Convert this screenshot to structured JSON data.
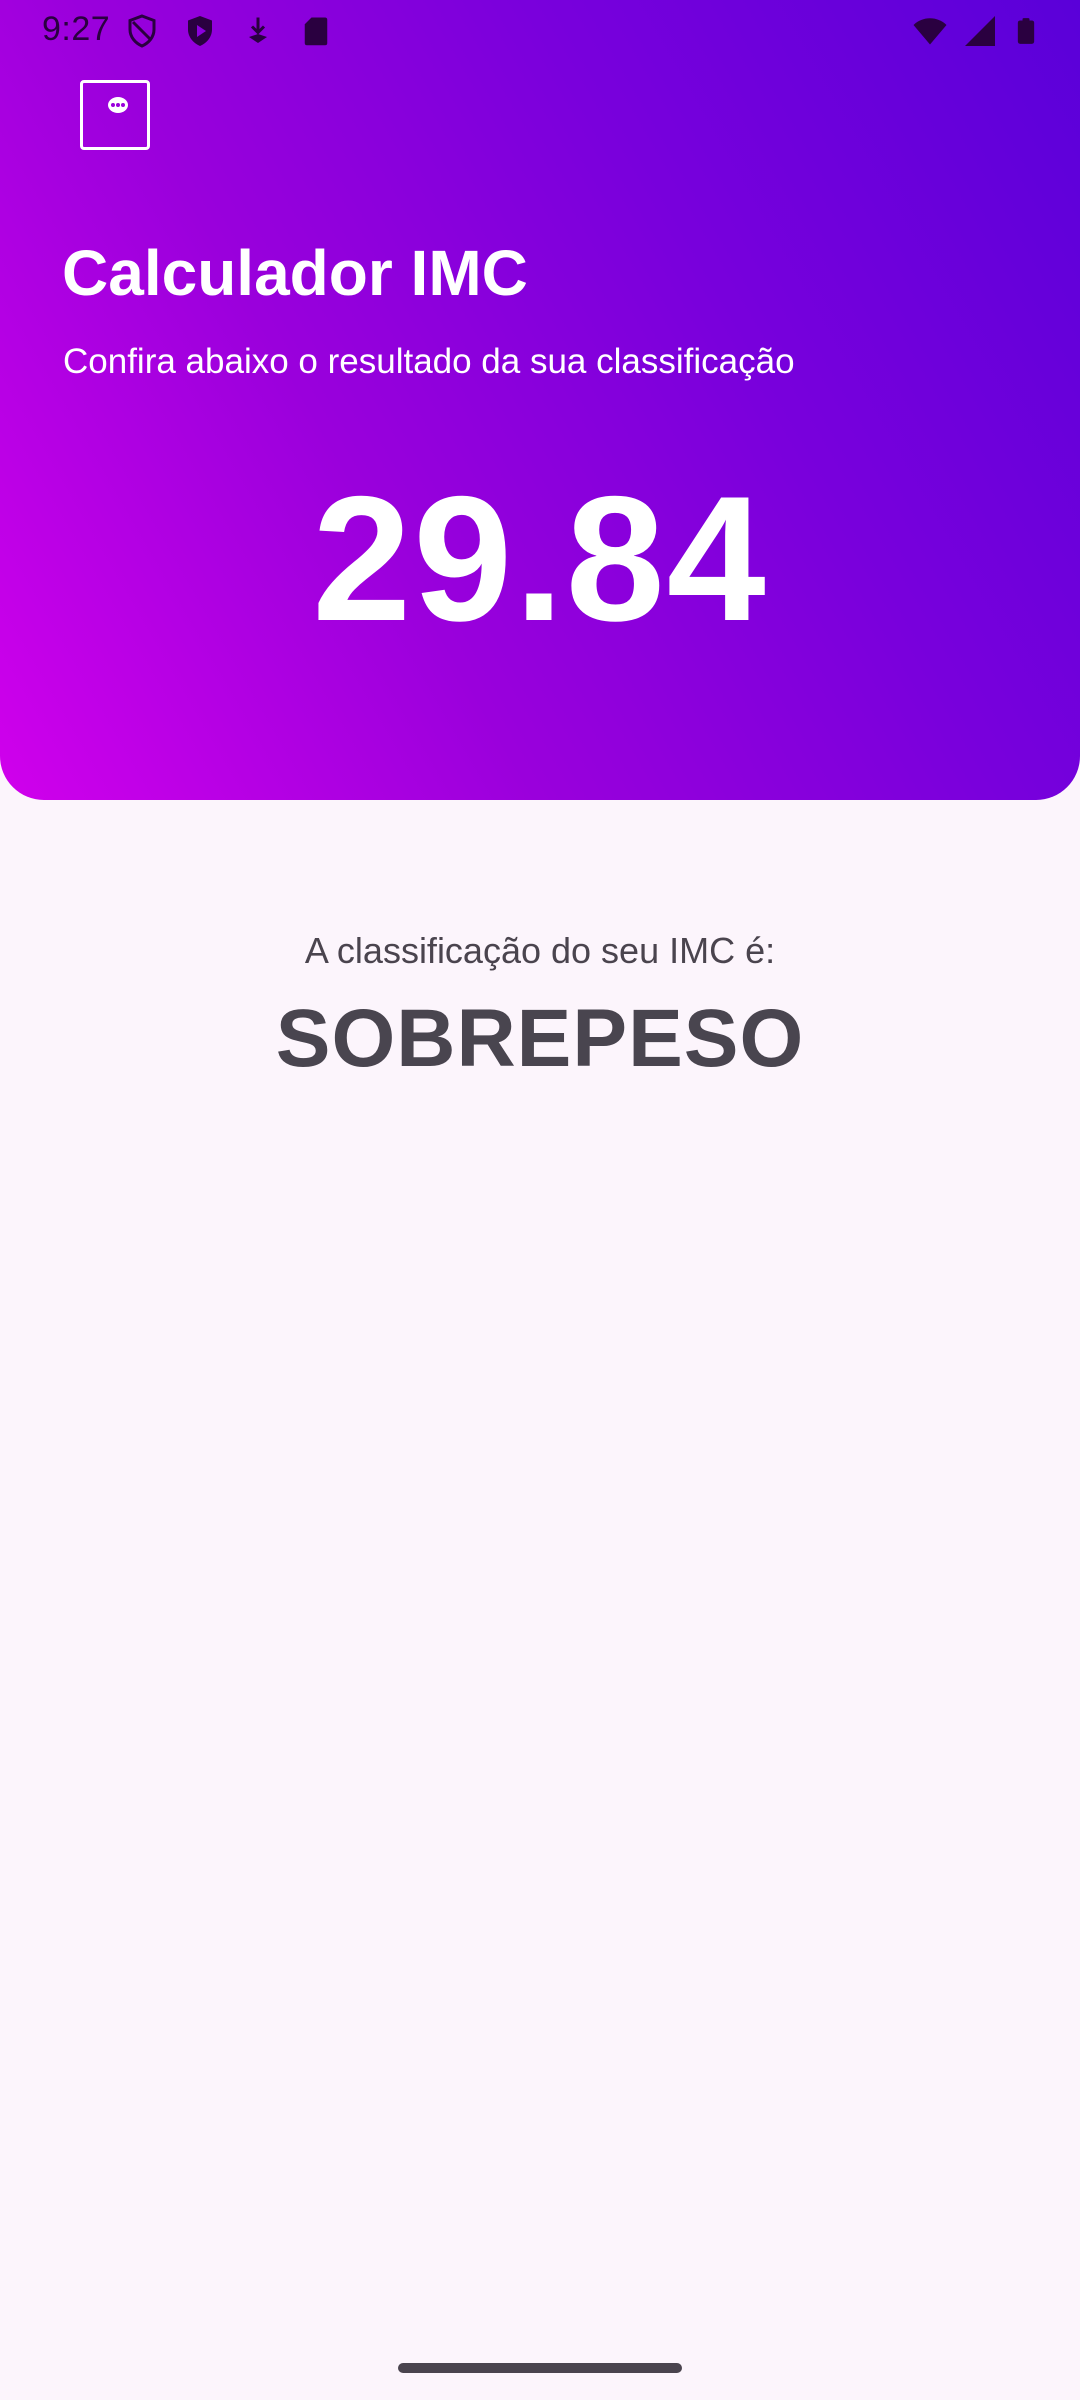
{
  "status_bar": {
    "time": "9:27",
    "left_icons": [
      "shield-outline-icon",
      "play-protect-icon",
      "download-arrow-icon",
      "sd-card-icon"
    ],
    "right_icons": [
      "wifi-icon",
      "cellular-signal-icon",
      "battery-icon"
    ]
  },
  "header": {
    "title": "Calculador IMC",
    "subtitle": "Confira abaixo o resultado da sua classificação",
    "imc_value": "29.84"
  },
  "result": {
    "label": "A classificação do seu IMC é:",
    "classification": "SOBREPESO"
  },
  "colors": {
    "gradient_start": "#d000ec",
    "gradient_end": "#5a00d9",
    "background": "#fcf5fc",
    "text_dark": "#49454f",
    "text_light": "#ffffff"
  }
}
